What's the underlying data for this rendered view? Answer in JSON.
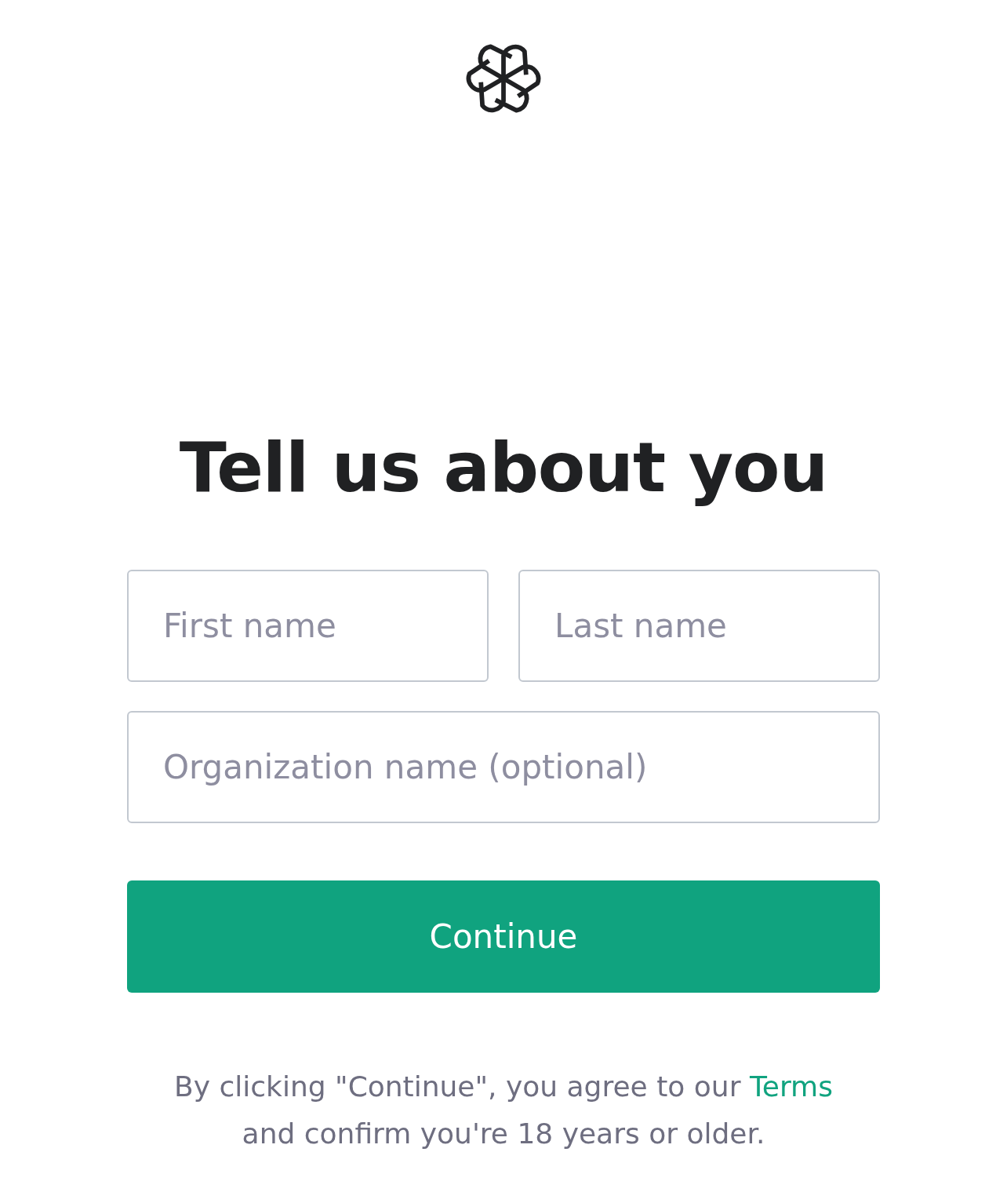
{
  "heading": "Tell us about you",
  "fields": [
    {
      "placeholder": "First name"
    },
    {
      "placeholder": "Last name"
    },
    {
      "placeholder": "Organization name (optional)"
    }
  ],
  "button": "Continue",
  "legal": {
    "before": "By clicking \"Continue\", you agree to our",
    "link": "Terms",
    "after": "and confirm you're 18 years or older."
  }
}
